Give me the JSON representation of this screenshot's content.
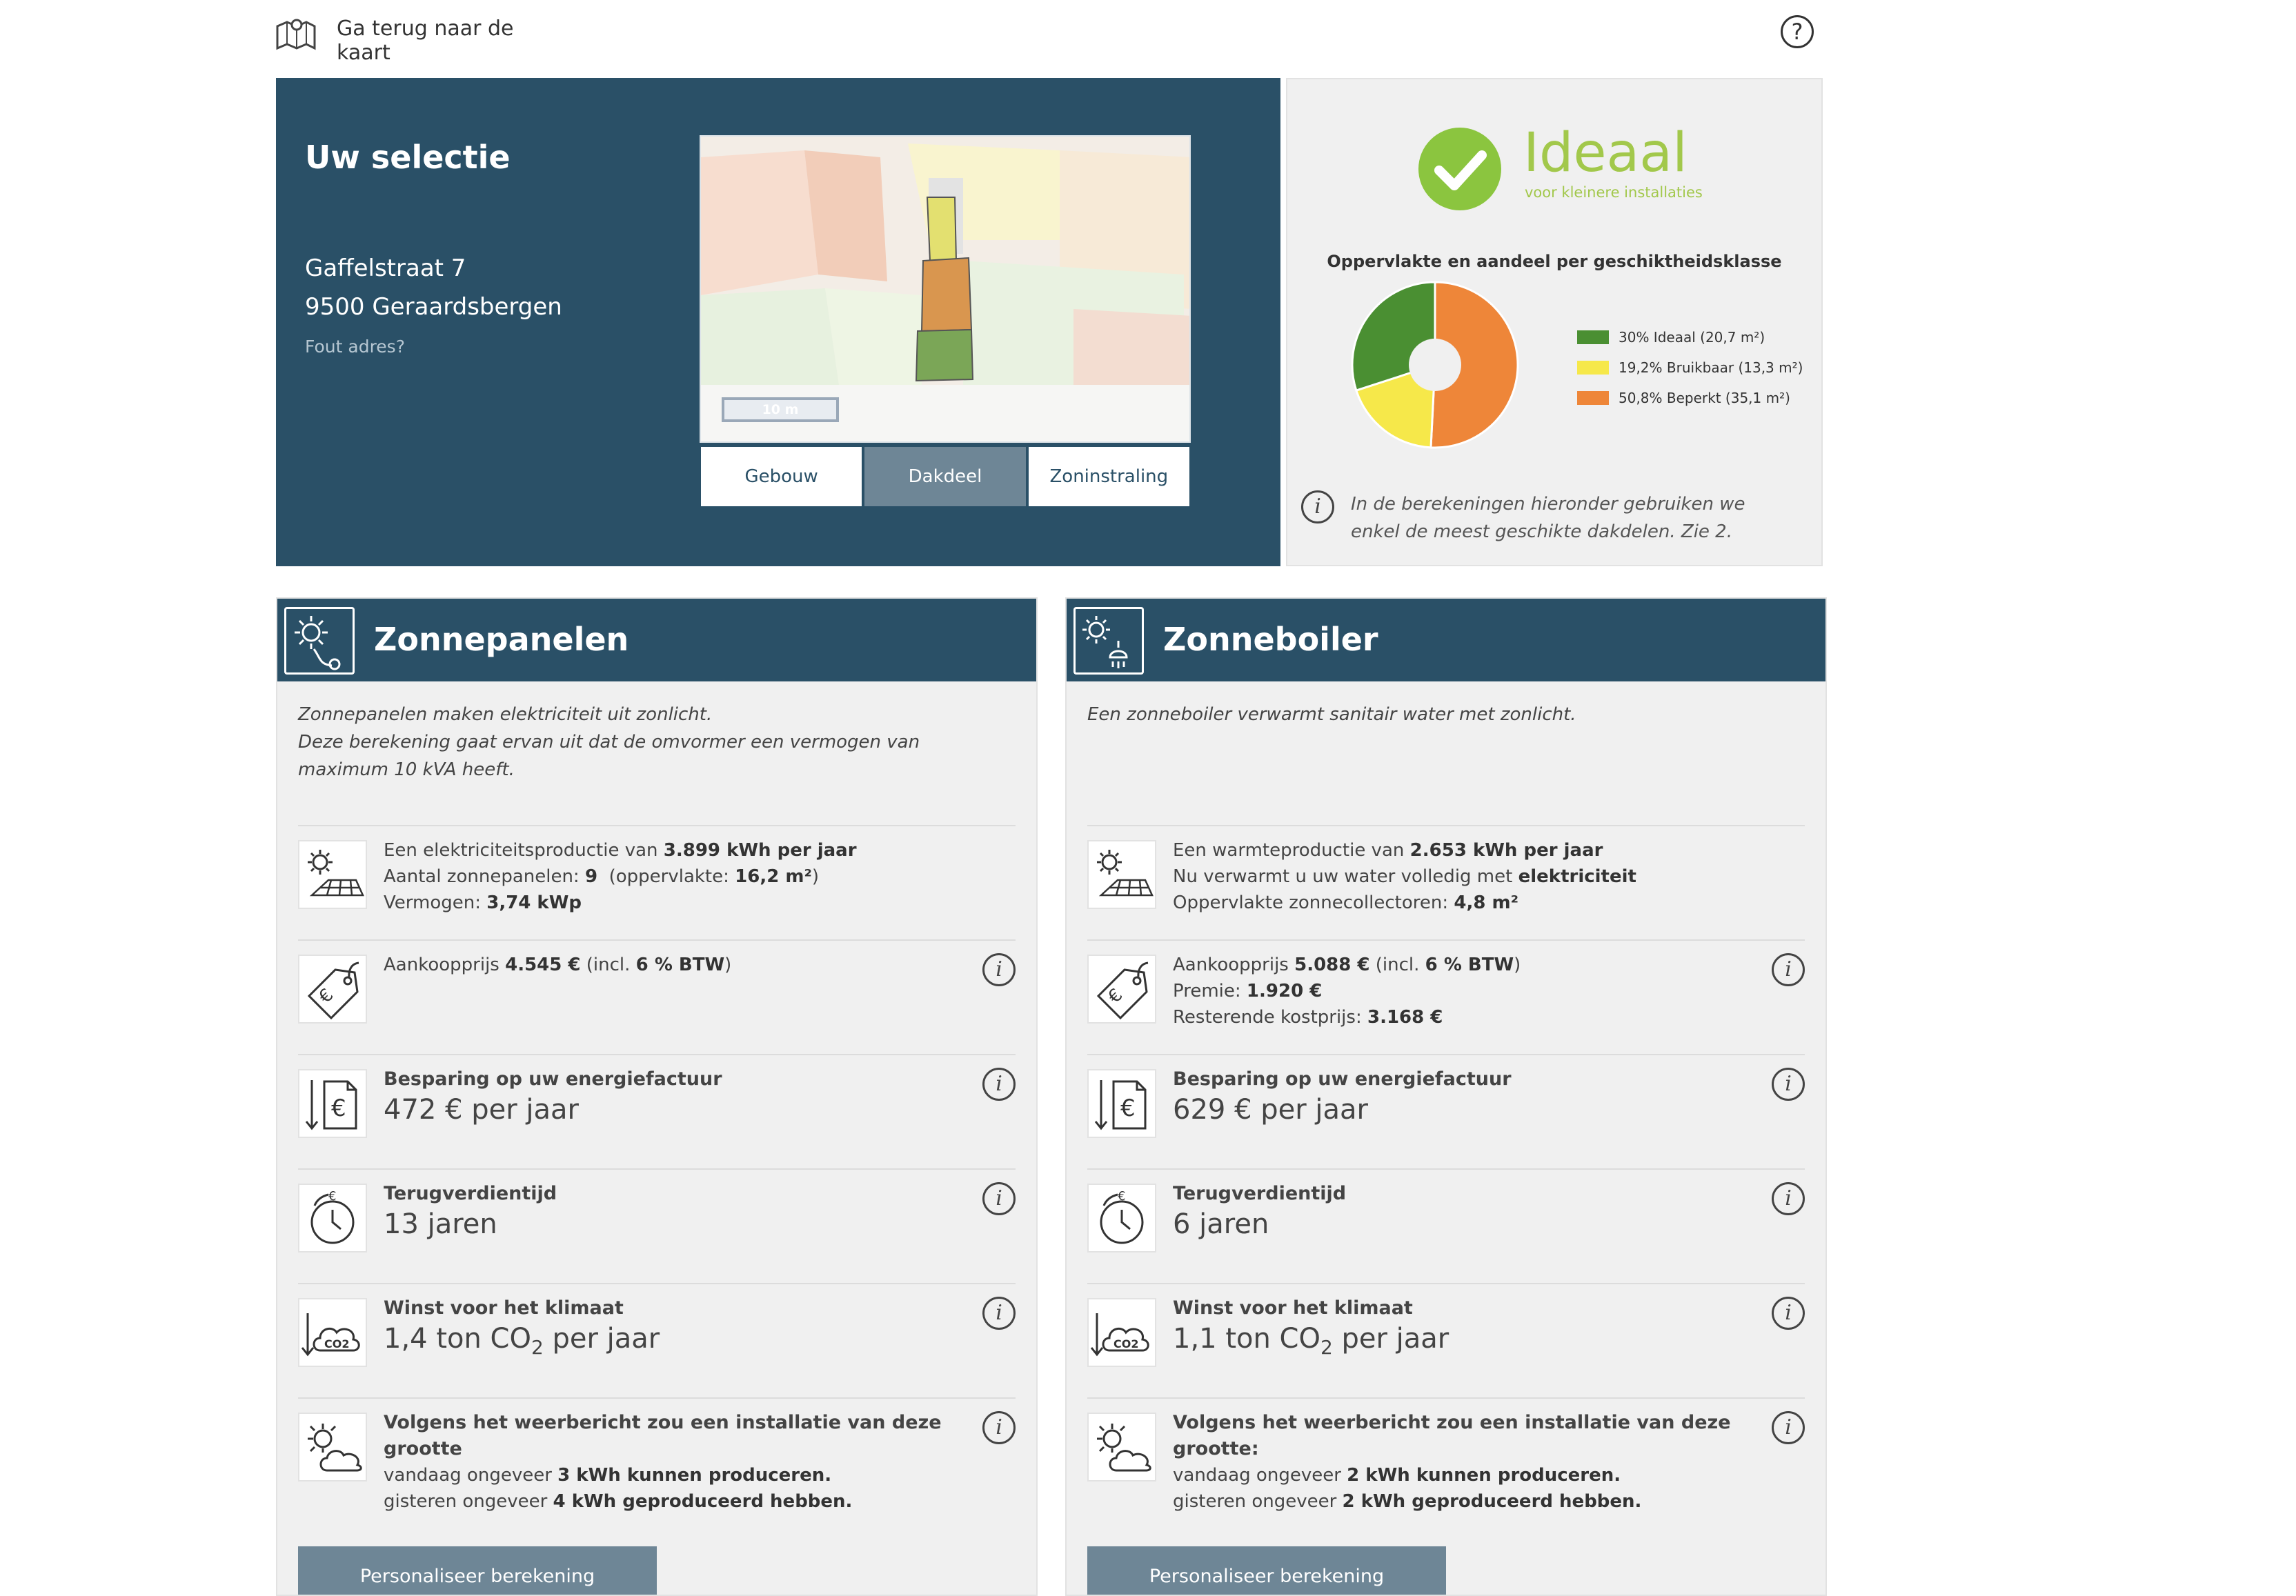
{
  "topbar": {
    "back_label": "Ga terug naar de kaart",
    "help_icon": "question-icon"
  },
  "selection": {
    "title": "Uw selectie",
    "street": "Gaffelstraat 7",
    "city": "9500 Geraardsbergen",
    "wrong_address": "Fout adres?",
    "map_scale": "10 m",
    "tabs": [
      "Gebouw",
      "Dakdeel",
      "Zoninstraling"
    ],
    "active_tab": "Dakdeel"
  },
  "result": {
    "rating": "Ideaal",
    "rating_sub": "voor kleinere installaties",
    "chart_title": "Oppervlakte en aandeel per geschiktheidsklasse",
    "note": "In de berekeningen hieronder gebruiken we enkel de meest geschikte dakdelen. Zie 2.",
    "colors": {
      "ideaal": "#4a8f32",
      "bruikbaar": "#f6e84a",
      "beperkt": "#ee8639"
    }
  },
  "chart_data": {
    "type": "pie",
    "title": "Oppervlakte en aandeel per geschiktheidsklasse",
    "categories": [
      "Ideaal",
      "Bruikbaar",
      "Beperkt"
    ],
    "values": [
      30,
      19.2,
      50.8
    ],
    "labels": [
      "30% Ideaal (20,7 m²)",
      "19,2% Bruikbaar (13,3 m²)",
      "50,8% Beperkt (35,1 m²)"
    ],
    "colors": [
      "#4a8f32",
      "#f6e84a",
      "#ee8639"
    ],
    "legend": "right"
  },
  "zonnepanelen": {
    "title": "Zonnepanelen",
    "intro1": "Zonnepanelen maken elektriciteit uit zonlicht.",
    "intro2": "Deze berekening gaat ervan uit dat de omvormer een vermogen van maximum 10 kVA heeft.",
    "prod_l1a": "Een elektriciteitsproductie van ",
    "prod_l1b": "3.899 kWh per jaar",
    "prod_l2a": "Aantal zonnepanelen: ",
    "prod_l2b": "9",
    "prod_l2c": "  (oppervlakte: ",
    "prod_l2d": "16,2 m²",
    "prod_l2e": ")",
    "prod_l3a": "Vermogen: ",
    "prod_l3b": "3,74 kWp",
    "price_a": "Aankoopprijs ",
    "price_b": "4.545 €",
    "price_c": " (incl. ",
    "price_d": "6 % BTW",
    "price_e": ")",
    "saving_head": "Besparing op uw energiefactuur",
    "saving_val": "472 € per jaar",
    "payback_head": "Terugverdientijd",
    "payback_val": "13 jaren",
    "climate_head": "Winst voor het klimaat",
    "climate_pre": "1,4 ton CO",
    "climate_sub": "2",
    "climate_post": " per jaar",
    "weather_head": "Volgens het weerbericht zou een installatie van deze grootte",
    "weather_l2a": "vandaag ongeveer ",
    "weather_l2b": "3 kWh kunnen produceren.",
    "weather_l3a": "gisteren ongeveer ",
    "weather_l3b": "4 kWh geproduceerd hebben.",
    "button": "Personaliseer berekening"
  },
  "zonneboiler": {
    "title": "Zonneboiler",
    "intro1": "Een zonneboiler verwarmt sanitair water met zonlicht.",
    "prod_l1a": "Een warmteproductie van ",
    "prod_l1b": "2.653 kWh per jaar",
    "prod_l2a": "Nu verwarmt u uw water volledig met ",
    "prod_l2b": "elektriciteit",
    "prod_l3a": "Oppervlakte zonnecollectoren: ",
    "prod_l3b": "4,8 m²",
    "price_a": "Aankoopprijs ",
    "price_b": "5.088 €",
    "price_c": " (incl. ",
    "price_d": "6 % BTW",
    "price_e": ")",
    "premie_a": "Premie: ",
    "premie_b": "1.920 €",
    "rest_a": "Resterende kostprijs: ",
    "rest_b": "3.168 €",
    "saving_head": "Besparing op uw energiefactuur",
    "saving_val": "629 € per jaar",
    "payback_head": "Terugverdientijd",
    "payback_val": "6 jaren",
    "climate_head": "Winst voor het klimaat",
    "climate_pre": "1,1 ton CO",
    "climate_sub": "2",
    "climate_post": " per jaar",
    "weather_head": "Volgens het weerbericht zou een installatie van deze grootte:",
    "weather_l2a": "vandaag ongeveer ",
    "weather_l2b": "2 kWh kunnen produceren.",
    "weather_l3a": "gisteren ongeveer ",
    "weather_l3b": "2 kWh geproduceerd hebben.",
    "button": "Personaliseer berekening"
  }
}
